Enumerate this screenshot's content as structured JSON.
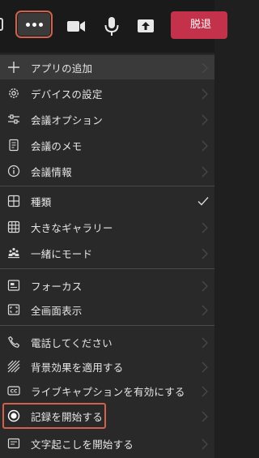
{
  "toolbar": {
    "more_icon": "more-horizontal-icon",
    "leave_label": "脱退",
    "icons": [
      "camera-icon",
      "microphone-icon",
      "share-tray-icon"
    ],
    "leave_color": "#c4314b",
    "highlight_color": "#d0624c"
  },
  "menu": {
    "items": [
      {
        "label": "アプリの追加",
        "icon": "plus-icon"
      },
      {
        "label": "デバイスの設定",
        "icon": "gear-icon"
      },
      {
        "label": "会議オプション",
        "icon": "sliders-icon"
      },
      {
        "label": "会議のメモ",
        "icon": "notes-icon"
      },
      {
        "label": "会議情報",
        "icon": "info-icon"
      },
      {
        "label": "種類",
        "icon": "grid-icon",
        "checked": true
      },
      {
        "label": "大きなギャラリー",
        "icon": "gallery-icon"
      },
      {
        "label": "一緒にモード",
        "icon": "together-mode-icon"
      },
      {
        "label": "フォーカス",
        "icon": "focus-icon"
      },
      {
        "label": "全画面表示",
        "icon": "fullscreen-icon"
      },
      {
        "label": "電話してください",
        "icon": "phone-icon"
      },
      {
        "label": "背景効果を適用する",
        "icon": "background-effects-icon"
      },
      {
        "label": "ライブキャプションを有効にする",
        "icon": "cc-icon"
      },
      {
        "label": "記録を開始する",
        "icon": "record-icon"
      },
      {
        "label": "文字起こしを開始する",
        "icon": "transcript-icon"
      }
    ]
  }
}
